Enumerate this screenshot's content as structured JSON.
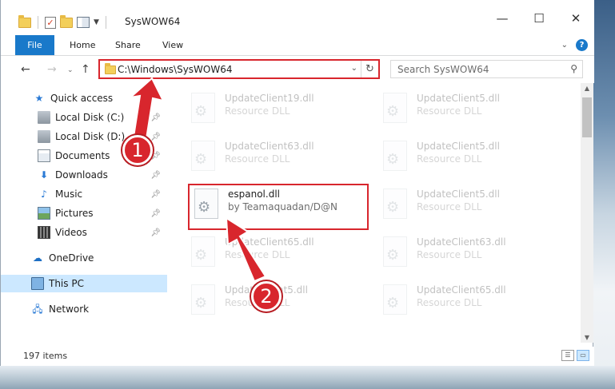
{
  "window": {
    "title": "SysWOW64"
  },
  "ribbon": {
    "tabs": [
      "File",
      "Home",
      "Share",
      "View"
    ]
  },
  "navigation": {
    "address": "C:\\Windows\\SysWOW64",
    "search_placeholder": "Search SysWOW64"
  },
  "sidebar": {
    "quick_access": "Quick access",
    "items": [
      {
        "label": "Local Disk (C:)",
        "icon": "drive-icon",
        "pinned": true
      },
      {
        "label": "Local Disk (D:)",
        "icon": "drive-icon",
        "pinned": true
      },
      {
        "label": "Documents",
        "icon": "documents-icon",
        "pinned": true
      },
      {
        "label": "Downloads",
        "icon": "downloads-icon",
        "pinned": true
      },
      {
        "label": "Music",
        "icon": "music-icon",
        "pinned": true
      },
      {
        "label": "Pictures",
        "icon": "pictures-icon",
        "pinned": true
      },
      {
        "label": "Videos",
        "icon": "videos-icon",
        "pinned": true
      }
    ],
    "onedrive": "OneDrive",
    "this_pc": "This PC",
    "network": "Network"
  },
  "files": [
    {
      "name": "UpdateClient19.dll",
      "desc": "Resource DLL",
      "faded": true
    },
    {
      "name": "UpdateClient5.dll",
      "desc": "Resource DLL",
      "faded": true
    },
    {
      "name": "UpdateClient63.dll",
      "desc": "Resource DLL",
      "faded": true
    },
    {
      "name": "UpdateClient5.dll",
      "desc": "Resource DLL",
      "faded": true
    },
    {
      "name": "espanol.dll",
      "desc": "by Teamaquadan/D@N",
      "faded": false
    },
    {
      "name": "UpdateClient5.dll",
      "desc": "Resource DLL",
      "faded": true
    },
    {
      "name": "UpdateClient65.dll",
      "desc": "Resource DLL",
      "faded": true
    },
    {
      "name": "UpdateClient63.dll",
      "desc": "Resource DLL",
      "faded": true
    },
    {
      "name": "UpdateClient5.dll",
      "desc": "Resource DLL",
      "faded": true
    },
    {
      "name": "UpdateClient65.dll",
      "desc": "Resource DLL",
      "faded": true
    }
  ],
  "status": {
    "item_count": "197 items"
  },
  "annotations": {
    "step1": "1",
    "step2": "2",
    "color": "#d8262d"
  }
}
